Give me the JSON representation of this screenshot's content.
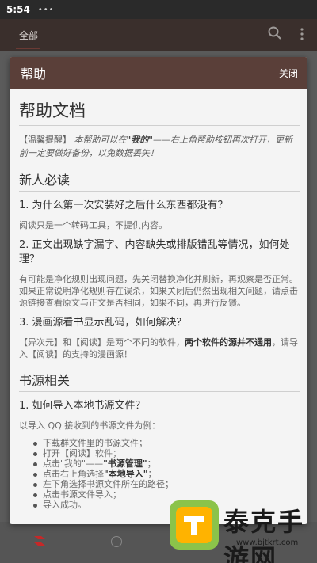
{
  "status_bar": {
    "time": "5:54",
    "dots": "•••"
  },
  "app_bar": {
    "tab_all": "全部"
  },
  "dialog": {
    "title": "帮助",
    "close_label": "关闭"
  },
  "doc": {
    "title": "帮助文档",
    "notice_prefix": "【温馨提醒】",
    "notice_text_1": " 本帮助可以在",
    "notice_bold": "\"我的\"",
    "notice_text_2": "——右上角帮助按钮再次打开，更新前一定要做好备份，以免数据丢失！",
    "section1_title": "新人必读",
    "q1": "1. 为什么第一次安装好之后什么东西都没有？",
    "a1": "阅读只是一个转码工具，不提供内容。",
    "q2": "2. 正文出现缺字漏字、内容缺失或排版错乱等情况，如何处理？",
    "a2": "有可能是净化规则出现问题，先关闭替换净化并刷新，再观察是否正常。如果正常说明净化规则存在误杀，如果关闭后仍然出现相关问题，请点击源链接查看原文与正文是否相同，如果不同，再进行反馈。",
    "q3": "3. 漫画源看书显示乱码，如何解决？",
    "a3_part1": "【异次元】和【阅读】是两个不同的软件，",
    "a3_bold": "两个软件的源并不通用",
    "a3_part2": "，请导入【阅读】的支持的漫画源！",
    "section2_title": "书源相关",
    "q4": "1. 如何导入本地书源文件？",
    "a4": "以导入 QQ 接收到的书源文件为例：",
    "steps": [
      {
        "text": "下载群文件里的书源文件；",
        "bold": ""
      },
      {
        "text": "打开【阅读】软件；",
        "bold": ""
      },
      {
        "text": "点击\"我的\"——",
        "bold": "\"书源管理\"",
        "after": "；"
      },
      {
        "text": "点击右上角选择",
        "bold": "\"本地导入\"",
        "after": "；"
      },
      {
        "text": "左下角选择书源文件所在的路径；",
        "bold": ""
      },
      {
        "text": "点击书源文件导入；",
        "bold": ""
      },
      {
        "text": "导入成功。",
        "bold": ""
      }
    ]
  },
  "watermark": {
    "text": "泰克手游网",
    "url": "www.bjtkrt.com"
  },
  "colors": {
    "header": "#5a3f39",
    "app_bar": "#3a2f2c",
    "overlay": "#5b5b5b"
  }
}
